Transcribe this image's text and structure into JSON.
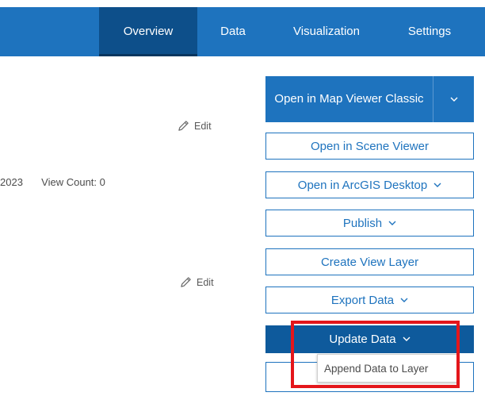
{
  "nav": {
    "tabs": [
      {
        "label": "Overview"
      },
      {
        "label": "Data"
      },
      {
        "label": "Visualization"
      },
      {
        "label": "Settings"
      }
    ]
  },
  "edit_label": "Edit",
  "meta": {
    "date_fragment": "2023",
    "view_count": "View Count: 0"
  },
  "actions": {
    "open_map_viewer_classic": "Open in Map Viewer Classic",
    "open_scene_viewer": "Open in Scene Viewer",
    "open_arcgis_desktop": "Open in ArcGIS Desktop",
    "publish": "Publish",
    "create_view_layer": "Create View Layer",
    "export_data": "Export Data",
    "update_data": "Update Data"
  },
  "dropdown": {
    "items": [
      {
        "label": "Append Data to Layer"
      }
    ]
  },
  "colors": {
    "nav_bg": "#1e73be",
    "nav_active": "#0d4f8a",
    "primary": "#1e73be",
    "update_bg": "#0e5a9c",
    "highlight": "#e4161b"
  }
}
